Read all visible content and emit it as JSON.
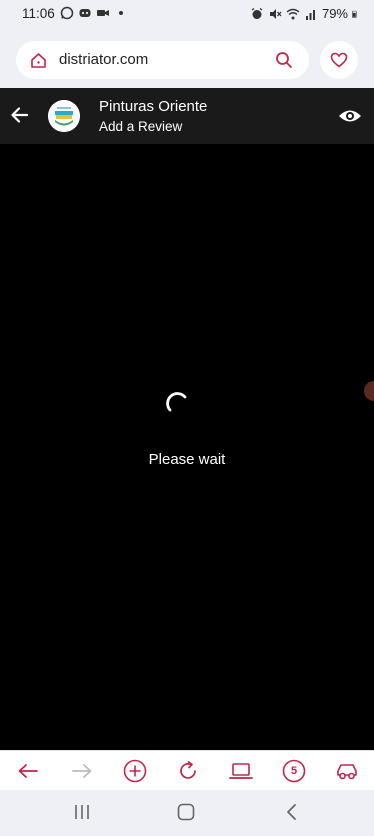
{
  "status_bar": {
    "time": "11:06",
    "battery": "79%",
    "left_icons": [
      "whatsapp-icon",
      "discord-icon",
      "video-icon",
      "dot-icon"
    ],
    "right_icons": [
      "alarm-icon",
      "mute-icon",
      "wifi-icon",
      "signal-icon",
      "battery-icon"
    ]
  },
  "browser": {
    "url": "distriator.com"
  },
  "header": {
    "title": "Pinturas Oriente",
    "subtitle": "Add a Review"
  },
  "main": {
    "loading_text": "Please wait"
  },
  "toolbar": {
    "tab_count": "5"
  },
  "colors": {
    "accent": "#c0264a",
    "header_bg": "#1a1a1a",
    "chrome_bg": "#eef0f5"
  }
}
